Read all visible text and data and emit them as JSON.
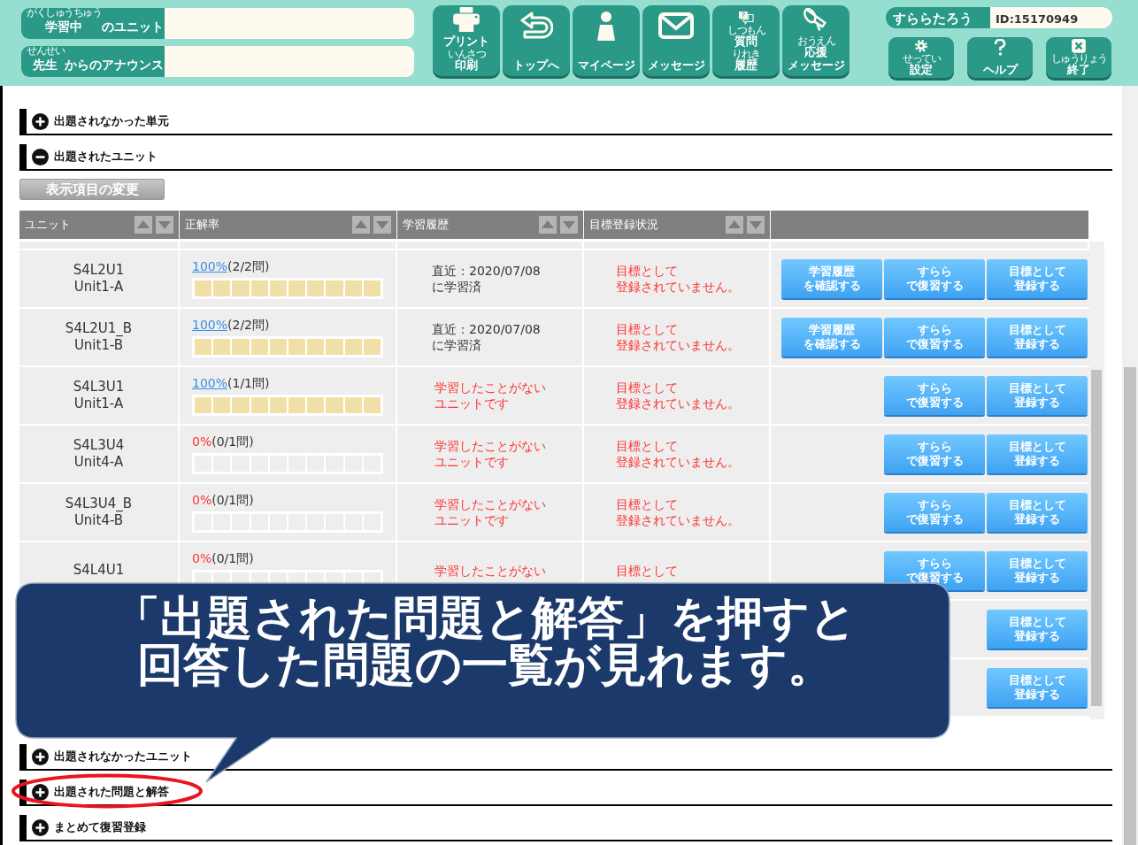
{
  "header": {
    "info_bars": [
      {
        "label": [
          {
            "text": "学習中",
            "ruby": "がくしゅうちゅう"
          },
          {
            "text": "のユニット"
          }
        ]
      },
      {
        "label": [
          {
            "text": "先生",
            "ruby": "せんせい"
          },
          {
            "text": "からのアナウンス"
          }
        ]
      }
    ],
    "nav_buttons": [
      {
        "kind": "print",
        "lines": [
          [
            {
              "text": "プリント"
            }
          ],
          [
            {
              "text": "印刷",
              "ruby": "いんさつ"
            }
          ]
        ]
      },
      {
        "kind": "top",
        "lines": [
          [
            {
              "text": "トップへ"
            }
          ]
        ]
      },
      {
        "kind": "mypage",
        "lines": [
          [
            {
              "text": "マイページ"
            }
          ]
        ]
      },
      {
        "kind": "message",
        "lines": [
          [
            {
              "text": "メッセージ"
            }
          ]
        ]
      },
      {
        "kind": "questions",
        "lines": [
          [
            {
              "text": "質問",
              "ruby": "しつもん"
            },
            {
              "text": "履歴",
              "ruby": "りれき"
            }
          ]
        ]
      },
      {
        "kind": "cheer",
        "lines": [
          [
            {
              "text": "応援",
              "ruby": "おうえん"
            }
          ],
          [
            {
              "text": "メッセージ"
            }
          ]
        ]
      }
    ],
    "user": {
      "name": "すららたろう",
      "id": "ID:15170949"
    },
    "utility_buttons": [
      {
        "kind": "settings",
        "lines": [
          [
            {
              "text": "設定",
              "ruby": "せってい"
            }
          ]
        ]
      },
      {
        "kind": "help",
        "lines": [
          [
            {
              "text": "ヘルプ"
            }
          ]
        ]
      },
      {
        "kind": "exit",
        "lines": [
          [
            {
              "text": "終了",
              "ruby": "しゅうりょう"
            }
          ]
        ]
      }
    ]
  },
  "sections_top": [
    {
      "title": "出題されなかった単元",
      "expanded": false
    },
    {
      "title": "出題されたユニット",
      "expanded": true
    }
  ],
  "display_button": "表示項目の変更",
  "table": {
    "columns": [
      {
        "label": "ユニット"
      },
      {
        "label": "正解率"
      },
      {
        "label": "学習履歴"
      },
      {
        "label": "目標登録状況"
      }
    ],
    "rows": [
      {
        "code": "S4L2U1",
        "name": "Unit1-A",
        "rate": "100%",
        "count": "(2/2問)",
        "level": 1,
        "history": [
          "直近：2020/07/08",
          "に学習済"
        ],
        "studied": true,
        "goal": [
          "目標として",
          "登録されていません。"
        ],
        "buttons": [
          [
            "学習履歴",
            "を確認する"
          ],
          [
            "すらら",
            "で復習する"
          ],
          [
            "目標として",
            "登録する"
          ]
        ]
      },
      {
        "code": "S4L2U1_B",
        "name": "Unit1-B",
        "rate": "100%",
        "count": "(2/2問)",
        "level": 1,
        "history": [
          "直近：2020/07/08",
          "に学習済"
        ],
        "studied": true,
        "goal": [
          "目標として",
          "登録されていません。"
        ],
        "buttons": [
          [
            "学習履歴",
            "を確認する"
          ],
          [
            "すらら",
            "で復習する"
          ],
          [
            "目標として",
            "登録する"
          ]
        ]
      },
      {
        "code": "S4L3U1",
        "name": "Unit1-A",
        "rate": "100%",
        "count": "(1/1問)",
        "level": 1,
        "history": [
          "学習したことがない",
          "ユニットです"
        ],
        "studied": false,
        "goal": [
          "目標として",
          "登録されていません。"
        ],
        "buttons": [
          [
            "すらら",
            "で復習する"
          ],
          [
            "目標として",
            "登録する"
          ]
        ]
      },
      {
        "code": "S4L3U4",
        "name": "Unit4-A",
        "rate": "0%",
        "count": "(0/1問)",
        "level": 0,
        "history": [
          "学習したことがない",
          "ユニットです"
        ],
        "studied": false,
        "goal": [
          "目標として",
          "登録されていません。"
        ],
        "buttons": [
          [
            "すらら",
            "で復習する"
          ],
          [
            "目標として",
            "登録する"
          ]
        ]
      },
      {
        "code": "S4L3U4_B",
        "name": "Unit4-B",
        "rate": "0%",
        "count": "(0/1問)",
        "level": 0,
        "history": [
          "学習したことがない",
          "ユニットです"
        ],
        "studied": false,
        "goal": [
          "目標として",
          "登録されていません。"
        ],
        "buttons": [
          [
            "すらら",
            "で復習する"
          ],
          [
            "目標として",
            "登録する"
          ]
        ]
      },
      {
        "code": "S4L4U1",
        "rate": "0%",
        "count": "(0/1問)",
        "level": 0,
        "history": [
          "学習したことがない"
        ],
        "studied": false,
        "goal": [
          "目標として"
        ],
        "buttons": [
          [
            "すらら",
            "で復習する"
          ],
          [
            "目標として",
            "登録する"
          ]
        ]
      },
      {
        "buttons": [
          [
            "目標として",
            "登録する"
          ]
        ]
      },
      {
        "buttons": [
          [
            "目標として",
            "登録する"
          ]
        ]
      }
    ]
  },
  "sections_bottom": [
    {
      "title": "出題されなかったユニット",
      "expanded": false,
      "highlighted": false
    },
    {
      "title": "出題された問題と解答",
      "expanded": false,
      "highlighted": true
    },
    {
      "title": "まとめて復習登録",
      "expanded": false,
      "highlighted": false
    }
  ],
  "callout": {
    "lines": [
      "「出題された問題と解答」を押すと",
      "回答した問題の一覧が見れます。"
    ]
  }
}
